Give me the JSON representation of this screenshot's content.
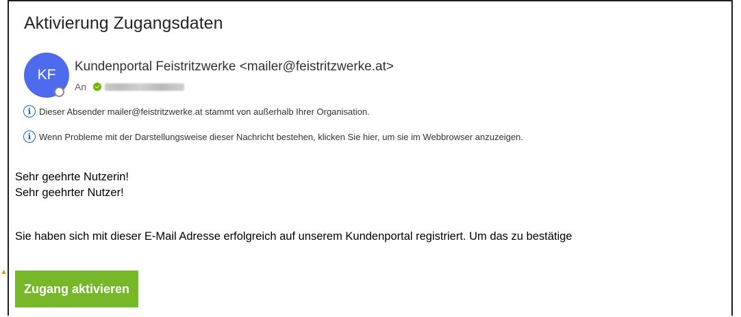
{
  "email": {
    "subject": "Aktivierung Zugangsdaten",
    "sender": {
      "initials": "KF",
      "display": "Kundenportal Feistritzwerke <mailer@feistritzwerke.at>"
    },
    "to_label": "An",
    "info_banners": [
      "Dieser Absender mailer@feistritzwerke.at stammt von außerhalb Ihrer Organisation.",
      "Wenn Probleme mit der Darstellungsweise dieser Nachricht bestehen, klicken Sie hier, um sie im Webbrowser anzuzeigen."
    ],
    "body": {
      "greeting_1": "Sehr geehrte Nutzerin!",
      "greeting_2": "Sehr geehrter Nutzer!",
      "paragraph": "Sie haben sich mit dieser E-Mail Adresse erfolgreich auf unserem Kundenportal registriert. Um das zu bestätige"
    },
    "cta_label": "Zugang aktivieren"
  },
  "colors": {
    "avatar": "#4f6bed",
    "cta": "#76b82a",
    "info_icon": "#0f6cbd",
    "presence_online": "#6bb700"
  },
  "icons": {
    "info": "info-circle-icon",
    "recipient_status": "online-check-icon",
    "presence": "presence-status-icon"
  }
}
